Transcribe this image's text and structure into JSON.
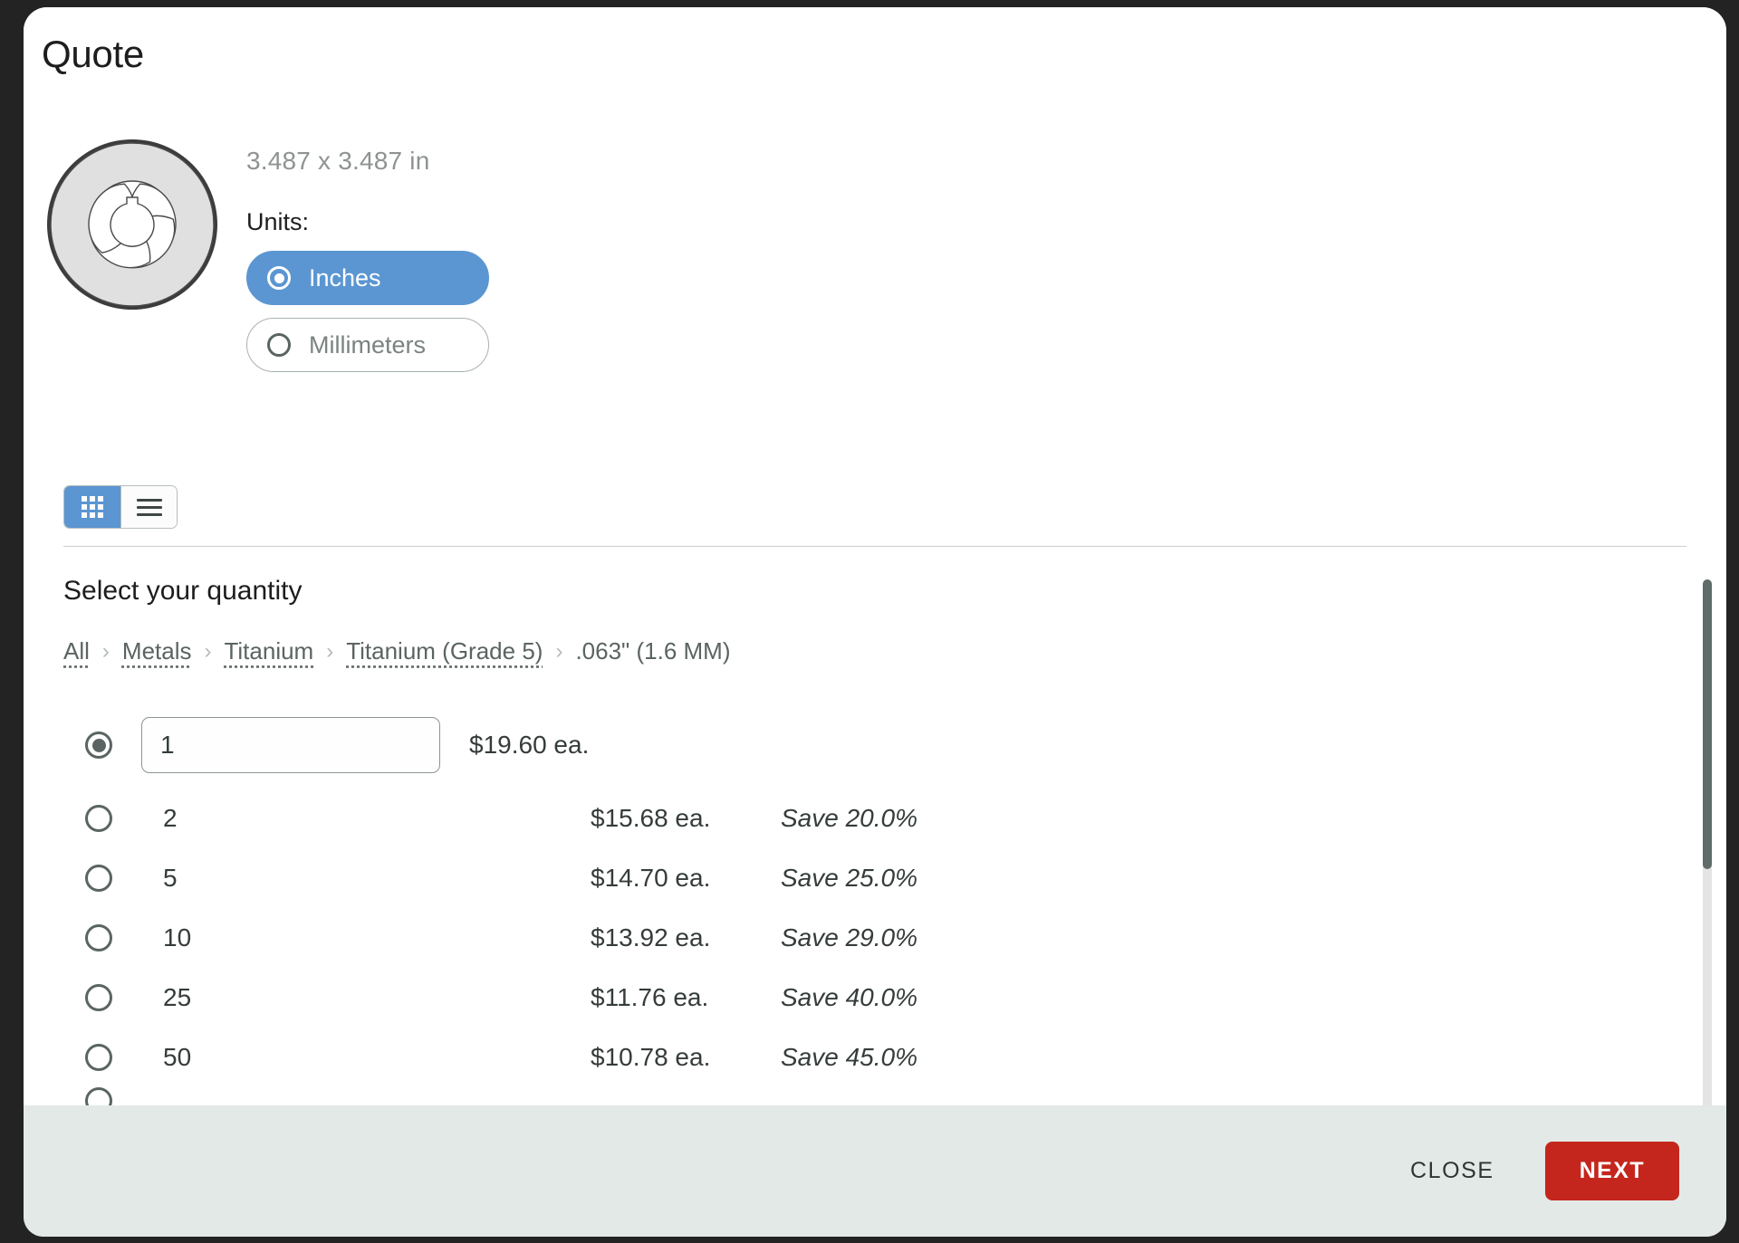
{
  "modal": {
    "title": "Quote"
  },
  "part": {
    "dimensions": "3.487 x 3.487 in",
    "thumbnail_icon": "gear-sprocket-icon"
  },
  "units": {
    "label": "Units:",
    "options": [
      {
        "label": "Inches",
        "selected": true
      },
      {
        "label": "Millimeters",
        "selected": false
      }
    ],
    "active_color": "#5b96d2"
  },
  "view_toggle": {
    "options": [
      {
        "icon": "grid-view-icon",
        "active": true
      },
      {
        "icon": "list-view-icon",
        "active": false
      }
    ]
  },
  "quantity": {
    "heading": "Select your quantity",
    "breadcrumb": [
      {
        "label": "All",
        "link": true
      },
      {
        "label": "Metals",
        "link": true
      },
      {
        "label": "Titanium",
        "link": true
      },
      {
        "label": "Titanium (Grade 5)",
        "link": true
      },
      {
        "label": ".063\" (1.6 MM)",
        "link": false
      }
    ],
    "separator": "›",
    "input_value": "1",
    "rows": [
      {
        "qty": "1",
        "price": "$19.60 ea.",
        "save": "",
        "selected": true,
        "is_input": true
      },
      {
        "qty": "2",
        "price": "$15.68 ea.",
        "save": "Save 20.0%",
        "selected": false,
        "is_input": false
      },
      {
        "qty": "5",
        "price": "$14.70 ea.",
        "save": "Save 25.0%",
        "selected": false,
        "is_input": false
      },
      {
        "qty": "10",
        "price": "$13.92 ea.",
        "save": "Save 29.0%",
        "selected": false,
        "is_input": false
      },
      {
        "qty": "25",
        "price": "$11.76 ea.",
        "save": "Save 40.0%",
        "selected": false,
        "is_input": false
      },
      {
        "qty": "50",
        "price": "$10.78 ea.",
        "save": "Save 45.0%",
        "selected": false,
        "is_input": false
      }
    ]
  },
  "footer": {
    "close_label": "CLOSE",
    "next_label": "NEXT",
    "next_color": "#c4261d"
  }
}
